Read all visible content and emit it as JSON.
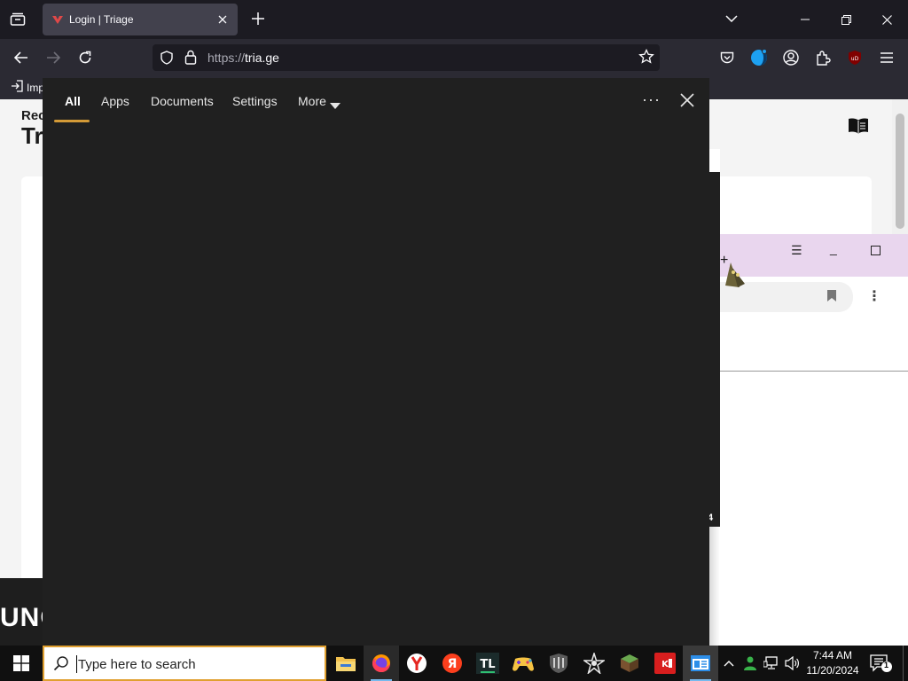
{
  "browser": {
    "tab": {
      "title": "Login | Triage"
    },
    "url": {
      "protocol": "https://",
      "host": "tria.ge"
    },
    "bookmarks": {
      "import_label": "Imp"
    }
  },
  "page": {
    "heading_small": "Rec",
    "heading_large": "Tr",
    "footer_text": "UNC"
  },
  "second_window": {
    "menu_glyph": "☰",
    "minimize_glyph": "_",
    "kebab_glyph": "⋮"
  },
  "third_window": {
    "fragment": "4"
  },
  "search_panel": {
    "tabs": [
      {
        "label": "All"
      },
      {
        "label": "Apps"
      },
      {
        "label": "Documents"
      },
      {
        "label": "Settings"
      },
      {
        "label": "More"
      }
    ],
    "active_tab_index": 0,
    "more_options_label": "···",
    "accent_color": "#d39a37"
  },
  "taskbar": {
    "search_placeholder": "Type here to search",
    "apps": [
      {
        "icon": "file-explorer-icon"
      },
      {
        "icon": "firefox-icon",
        "running": true
      },
      {
        "icon": "yandex-browser-icon"
      },
      {
        "icon": "yandex-icon"
      },
      {
        "icon": "tlauncher-icon"
      },
      {
        "icon": "game-controller-icon"
      },
      {
        "icon": "world-of-tanks-icon"
      },
      {
        "icon": "star-game-icon"
      },
      {
        "icon": "minecraft-icon"
      },
      {
        "icon": "kj-app-icon"
      },
      {
        "icon": "windows-app-icon",
        "running": true
      }
    ],
    "clock": {
      "time": "7:44 AM",
      "date": "11/20/2024"
    },
    "notifications_count": "1"
  }
}
